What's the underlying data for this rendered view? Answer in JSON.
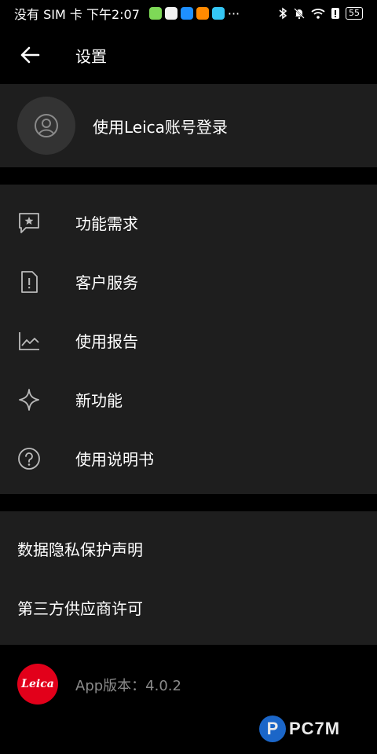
{
  "status_bar": {
    "left_text": "没有 SIM 卡 下午2:07",
    "more": "···",
    "battery": "55",
    "app_icon_colors": [
      "#7ed957",
      "#f2f2f2",
      "#1e90ff",
      "#ff8a00",
      "#35c6f4"
    ]
  },
  "header": {
    "title": "设置"
  },
  "account": {
    "label": "使用Leica账号登录"
  },
  "menu": {
    "items": [
      {
        "label": "功能需求",
        "icon": "feedback-star-icon"
      },
      {
        "label": "客户服务",
        "icon": "document-alert-icon"
      },
      {
        "label": "使用报告",
        "icon": "line-chart-icon"
      },
      {
        "label": "新功能",
        "icon": "sparkle-icon"
      },
      {
        "label": "使用说明书",
        "icon": "help-circle-icon"
      }
    ]
  },
  "legal": {
    "items": [
      {
        "label": "数据隐私保护声明"
      },
      {
        "label": "第三方供应商许可"
      }
    ]
  },
  "footer": {
    "logo_text": "Leica",
    "version": "App版本：4.0.2"
  },
  "watermark": {
    "text": "PC7M"
  },
  "colors": {
    "background": "#000000",
    "card": "#1e1e1e",
    "avatar_bg": "#333333",
    "leica_red": "#e2001a",
    "muted_text": "#8a8a8a"
  }
}
